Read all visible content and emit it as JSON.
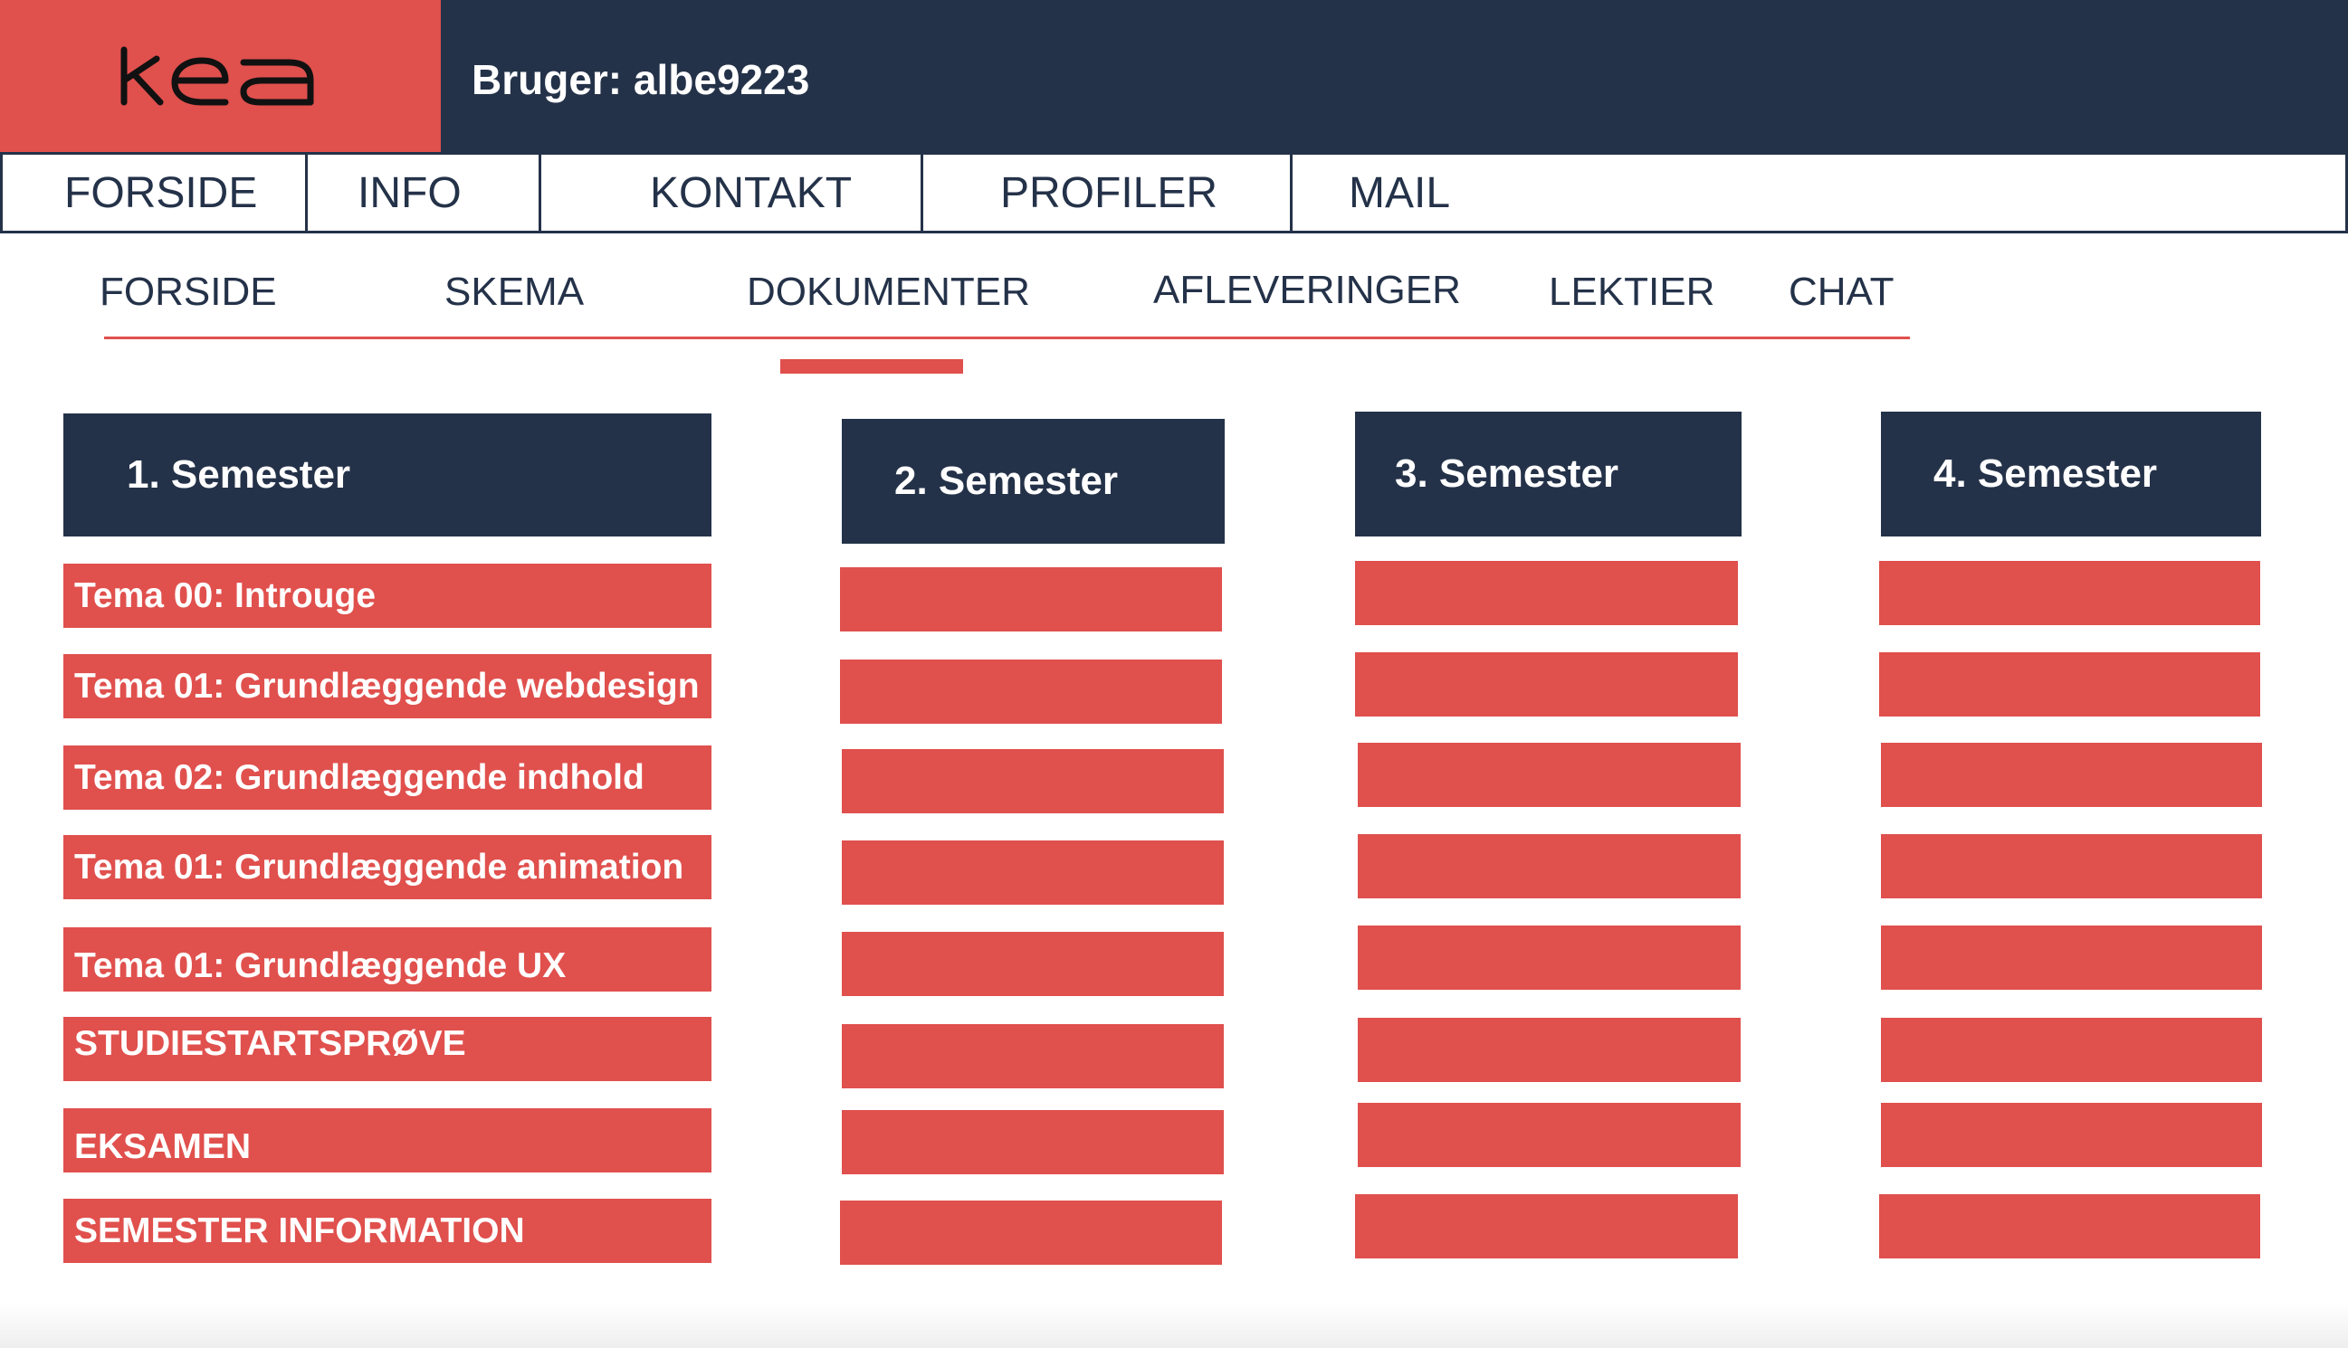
{
  "header": {
    "logo_text": "kea",
    "user_label": "Bruger: albe9223"
  },
  "main_nav": [
    "FORSIDE",
    "INFO",
    "KONTAKT",
    "PROFILER",
    "MAIL"
  ],
  "sub_nav": {
    "items": [
      "FORSIDE",
      "SKEMA",
      "DOKUMENTER",
      "AFLEVERINGER",
      "LEKTIER",
      "CHAT"
    ],
    "active": "DOKUMENTER"
  },
  "semesters": [
    {
      "title": "1. Semester",
      "items": [
        "Tema 00: Introuge",
        "Tema 01: Grundlæggende webdesign",
        "Tema 02: Grundlæggende indhold",
        "Tema 01: Grundlæggende animation",
        "Tema 01: Grundlæggende UX",
        "STUDIESTARTSPRØVE",
        "EKSAMEN",
        "SEMESTER INFORMATION"
      ]
    },
    {
      "title": "2. Semester"
    },
    {
      "title": "3. Semester"
    },
    {
      "title": "4. Semester"
    }
  ],
  "colors": {
    "navy": "#243249",
    "accent_red": "#e0504d",
    "white": "#ffffff"
  }
}
